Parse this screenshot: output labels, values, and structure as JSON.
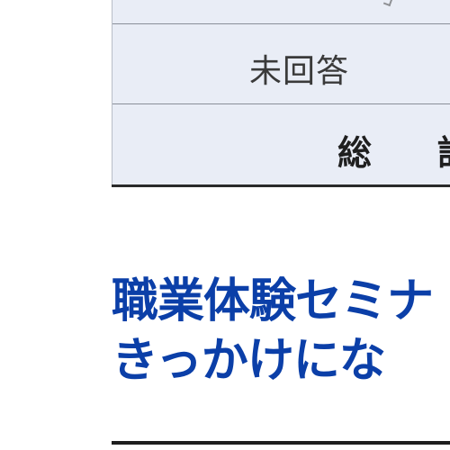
{
  "table": {
    "rows": [
      {
        "label": "未回答"
      },
      {
        "label": "総計"
      }
    ]
  },
  "heading": {
    "line1": "職業体験セミナ",
    "line2": "きっかけにな"
  },
  "colors": {
    "table_bg": "#e9edf6",
    "heading": "#0b3fa8",
    "rule": "#1e1e1e"
  }
}
